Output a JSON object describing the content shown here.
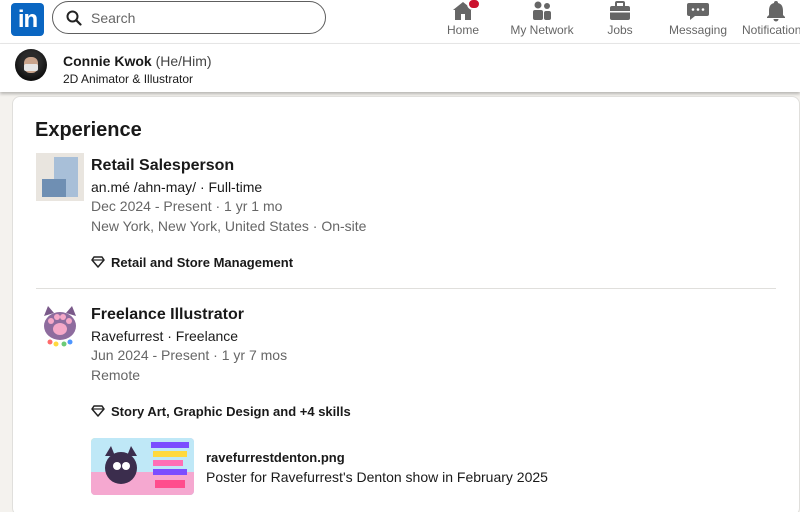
{
  "nav": {
    "logo_text": "in",
    "search_placeholder": "Search",
    "items": [
      {
        "label": "Home",
        "icon": "home-icon"
      },
      {
        "label": "My Network",
        "icon": "network-icon"
      },
      {
        "label": "Jobs",
        "icon": "briefcase-icon"
      },
      {
        "label": "Messaging",
        "icon": "messaging-icon"
      },
      {
        "label": "Notifications",
        "icon": "bell-icon"
      }
    ],
    "accent": "#0a66c2",
    "badge_color": "#cb112d"
  },
  "profile": {
    "name": "Connie Kwok",
    "pronouns": "(He/Him)",
    "headline": "2D Animator & Illustrator"
  },
  "experience": {
    "title": "Experience",
    "entries": [
      {
        "role": "Retail Salesperson",
        "company": "an.mé /ahn-may/ · Full-time",
        "dates": "Dec 2024 - Present · 1 yr 1 mo",
        "location": "New York, New York, United States · On-site",
        "skills": "Retail and Store Management"
      },
      {
        "role": "Freelance Illustrator",
        "company": "Ravefurrest · Freelance",
        "dates": "Jun 2024 - Present · 1 yr 7 mos",
        "location": "Remote",
        "skills": "Story Art, Graphic Design and +4 skills",
        "media": {
          "file": "ravefurrestdenton.png",
          "description": "Poster for Ravefurrest's Denton show in February 2025"
        }
      }
    ]
  }
}
